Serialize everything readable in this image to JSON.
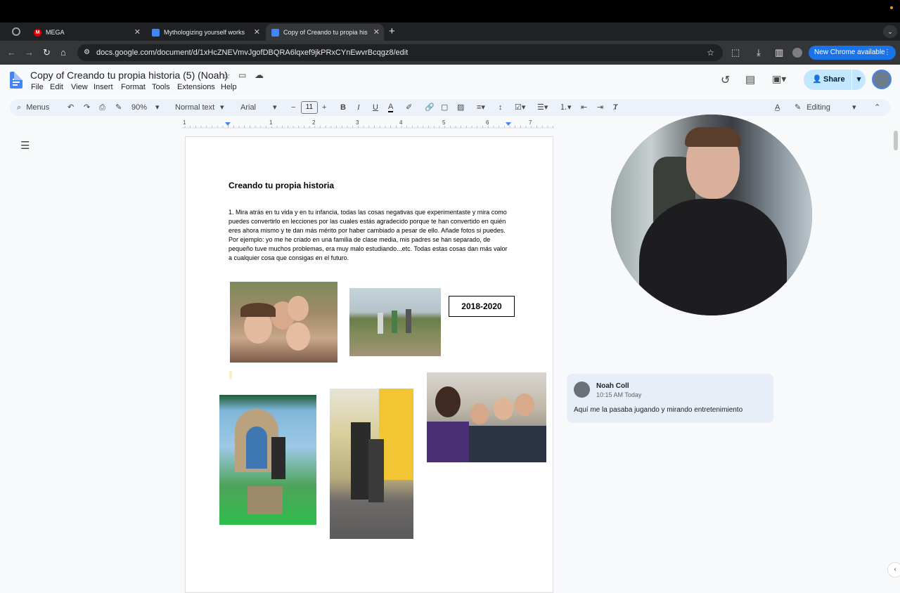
{
  "browser": {
    "tabs": [
      {
        "title": "MEGA",
        "active": false
      },
      {
        "title": "Mythologizing yourself works",
        "active": false
      },
      {
        "title": "Copy of Creando tu propia historia",
        "active": true
      }
    ],
    "url": "docs.google.com/document/d/1xHcZNEVmvJgofDBQRA6lqxef9jkPRxCYnEwvrBcqgz8/edit",
    "update_button": "New Chrome available"
  },
  "docs": {
    "title": "Copy of Creando tu propia historia (5) (Noah)",
    "menus": [
      "File",
      "Edit",
      "View",
      "Insert",
      "Format",
      "Tools",
      "Extensions",
      "Help"
    ],
    "share_label": "Share",
    "toolbar": {
      "menus_search": "Menus",
      "zoom": "90%",
      "style": "Normal text",
      "font": "Arial",
      "font_size": "11",
      "mode": "Editing"
    },
    "ruler_numbers": [
      "1",
      "1",
      "2",
      "3",
      "4",
      "5",
      "6",
      "7"
    ]
  },
  "document": {
    "heading": "Creando tu propia historia",
    "paragraph": "1. Mira atrás en tu vida y en tu infancia, todas las cosas negativas que experimentaste y mira como puedes convertirlo en lecciones por las cuales estás agradecido porque te han convertido en quién eres ahora mismo y te dan más mérito por haber cambiado a pesar de ello. Añade fotos si puedes. Por ejemplo: yo me he criado en una familia de clase media, mis padres se han separado, de pequeño tuve muchos problemas, era muy malo estudiando...etc. Todas estas cosas dan más valor a cualquier cosa que consigas en el futuro.",
    "year_box": "2018-2020"
  },
  "comment": {
    "author": "Noah Coll",
    "time": "10:15 AM Today",
    "text": "Aquí me la pasaba jugando y mirando entretenimiento"
  },
  "colors": {
    "accent": "#1a73e8",
    "share_bg": "#c2e7ff",
    "docs_blue": "#4285f4",
    "comment_bg": "#e8eef7"
  }
}
